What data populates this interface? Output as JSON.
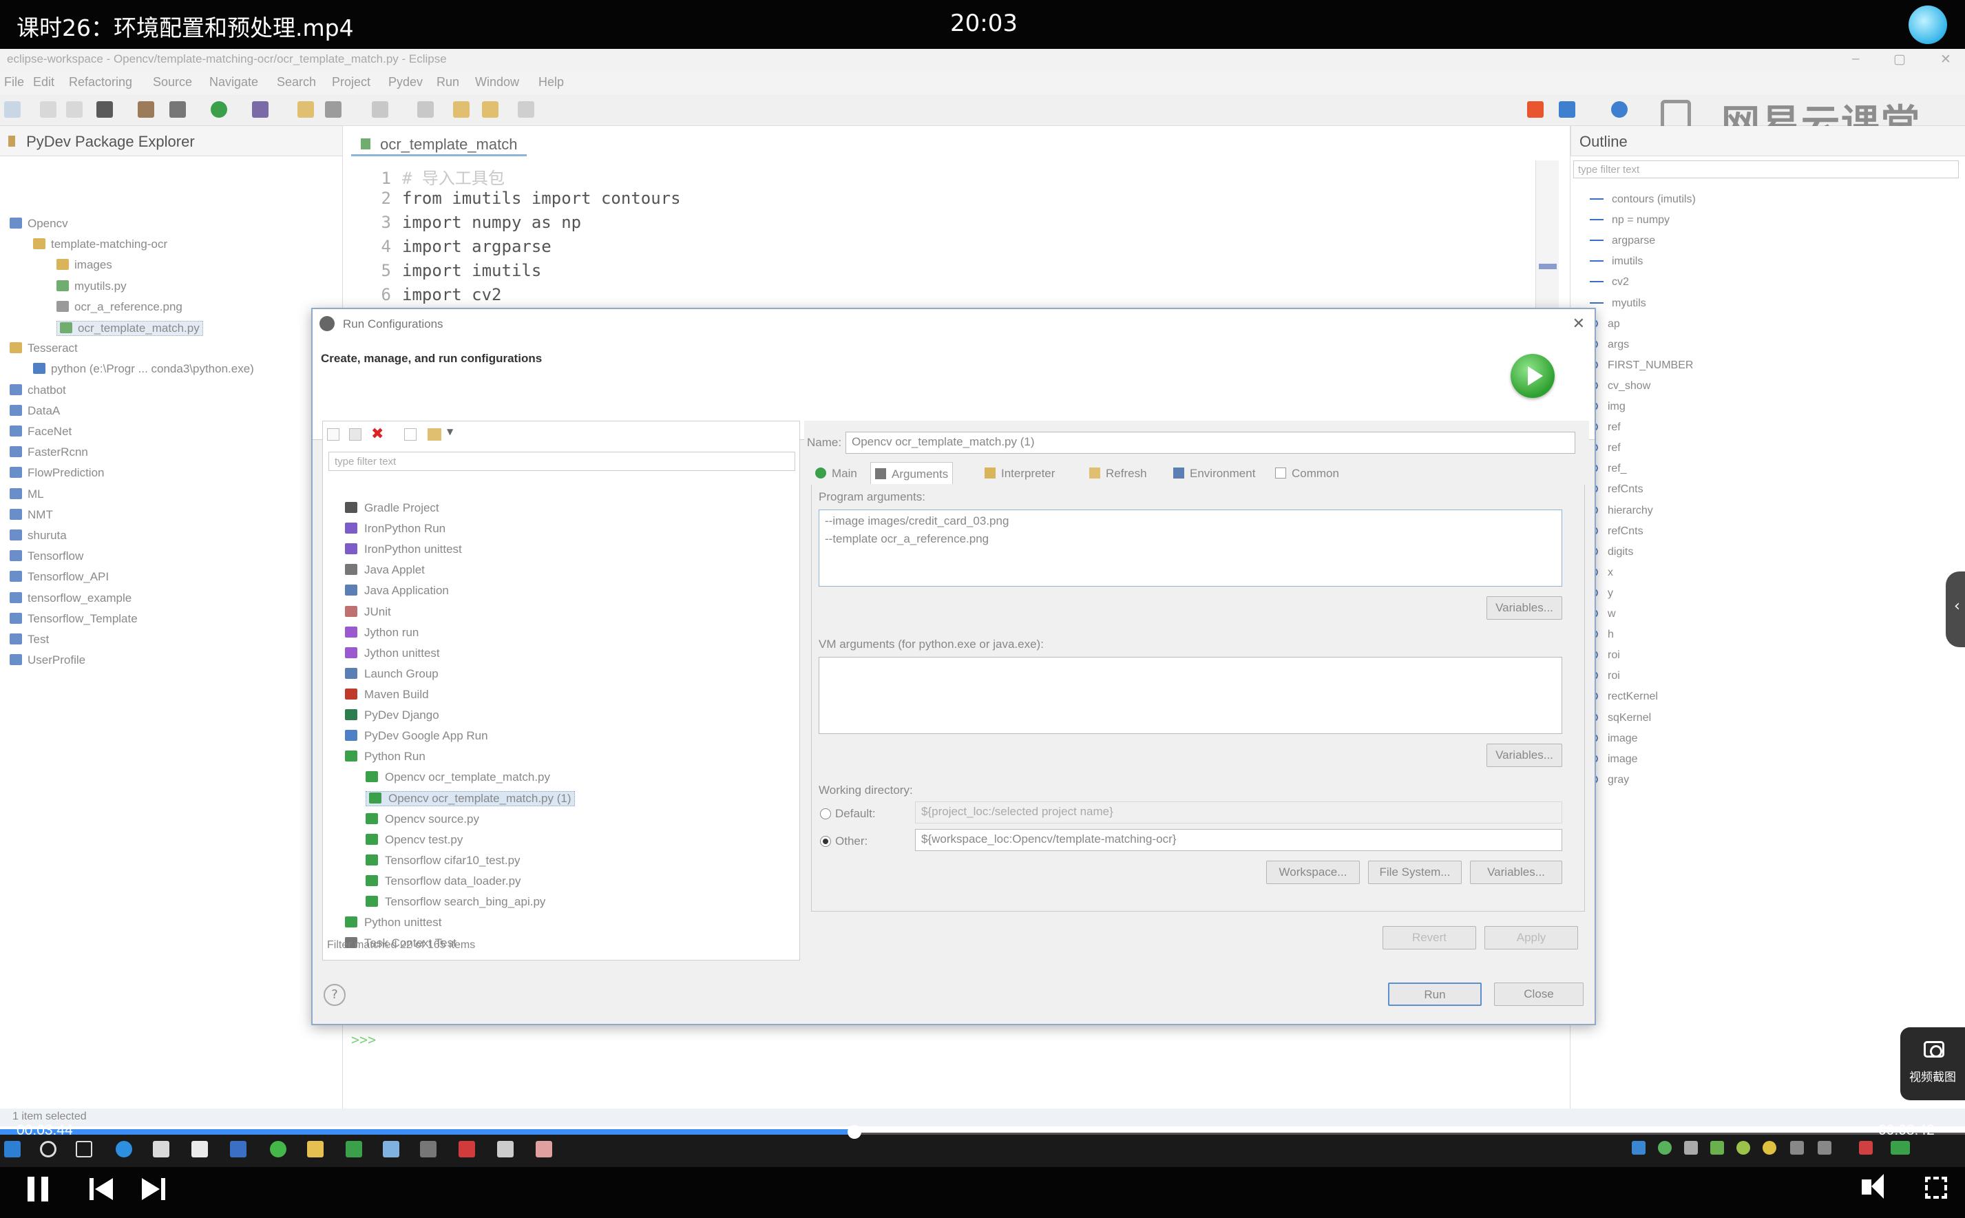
{
  "video": {
    "title": "课时26：环境配置和预处理.mp4",
    "clock": "20:03",
    "time_current": "00:03:44",
    "time_total": "00:08:42",
    "progress": 0.435,
    "screenshot_label": "视频截图"
  },
  "eclipse": {
    "window_title": "eclipse-workspace - Opencv/template-matching-ocr/ocr_template_match.py - Eclipse",
    "menu": [
      "File",
      "Edit",
      "Refactoring",
      "Source",
      "Navigate",
      "Search",
      "Project",
      "Pydev",
      "Run",
      "Window",
      "Help"
    ],
    "watermark": "网易云课堂",
    "package_explorer": {
      "title": "PyDev Package Explorer",
      "tree": [
        {
          "label": "Opencv",
          "depth": 0,
          "color": "#6a8ec9"
        },
        {
          "label": "template-matching-ocr",
          "depth": 1,
          "color": "#d9b45a"
        },
        {
          "label": "images",
          "depth": 2,
          "color": "#d9b45a"
        },
        {
          "label": "myutils.py",
          "depth": 2,
          "color": "#6fae6f"
        },
        {
          "label": "ocr_a_reference.png",
          "depth": 2,
          "color": "#9a9a9a"
        },
        {
          "label": "ocr_template_match.py",
          "depth": 2,
          "color": "#6fae6f",
          "selected": true
        },
        {
          "label": "Tesseract",
          "depth": 0,
          "color": "#d9b45a"
        },
        {
          "label": "python  (e:\\Progr ... conda3\\python.exe)",
          "depth": 1,
          "color": "#4f7fc4"
        },
        {
          "label": "chatbot",
          "depth": 0,
          "color": "#6a8ec9"
        },
        {
          "label": "DataA",
          "depth": 0,
          "color": "#6a8ec9"
        },
        {
          "label": "FaceNet",
          "depth": 0,
          "color": "#6a8ec9"
        },
        {
          "label": "FasterRcnn",
          "depth": 0,
          "color": "#6a8ec9"
        },
        {
          "label": "FlowPrediction",
          "depth": 0,
          "color": "#6a8ec9"
        },
        {
          "label": "ML",
          "depth": 0,
          "color": "#6a8ec9"
        },
        {
          "label": "NMT",
          "depth": 0,
          "color": "#6a8ec9"
        },
        {
          "label": "shuruta",
          "depth": 0,
          "color": "#6a8ec9"
        },
        {
          "label": "Tensorflow",
          "depth": 0,
          "color": "#6a8ec9"
        },
        {
          "label": "Tensorflow_API",
          "depth": 0,
          "color": "#6a8ec9"
        },
        {
          "label": "tensorflow_example",
          "depth": 0,
          "color": "#6a8ec9"
        },
        {
          "label": "Tensorflow_Template",
          "depth": 0,
          "color": "#6a8ec9"
        },
        {
          "label": "Test",
          "depth": 0,
          "color": "#6a8ec9"
        },
        {
          "label": "UserProfile",
          "depth": 0,
          "color": "#6a8ec9"
        }
      ]
    },
    "editor": {
      "tab": "ocr_template_match",
      "lines": [
        {
          "n": "1",
          "text": "# 导入工具包"
        },
        {
          "n": "2",
          "text": "from imutils import contours"
        },
        {
          "n": "3",
          "text": "import numpy as np"
        },
        {
          "n": "4",
          "text": "import argparse"
        },
        {
          "n": "5",
          "text": "import imutils"
        },
        {
          "n": "6",
          "text": "import cv2"
        }
      ]
    },
    "outline": {
      "title": "Outline",
      "filter_placeholder": "type filter text",
      "items": [
        "contours (imutils)",
        "np = numpy",
        "argparse",
        "imutils",
        "cv2",
        "myutils",
        "ap",
        "args",
        "FIRST_NUMBER",
        "cv_show",
        "img",
        "ref",
        "ref",
        "ref_",
        "refCnts",
        "hierarchy",
        "refCnts",
        "digits",
        "x",
        "y",
        "w",
        "h",
        "roi",
        "roi",
        "rectKernel",
        "sqKernel",
        "image",
        "image",
        "gray"
      ]
    },
    "console_prompt": ">>>",
    "status": "1 item selected"
  },
  "dialog": {
    "title": "Run Configurations",
    "subtitle": "Create, manage, and run configurations",
    "filter_placeholder": "type filter text",
    "configs": [
      {
        "label": "Gradle Project",
        "depth": 0,
        "color": "#555"
      },
      {
        "label": "IronPython Run",
        "depth": 0,
        "color": "#7b5cc9"
      },
      {
        "label": "IronPython unittest",
        "depth": 0,
        "color": "#7b5cc9"
      },
      {
        "label": "Java Applet",
        "depth": 0,
        "color": "#777"
      },
      {
        "label": "Java Application",
        "depth": 0,
        "color": "#5b7fb5"
      },
      {
        "label": "JUnit",
        "depth": 0,
        "color": "#c07070"
      },
      {
        "label": "Jython run",
        "depth": 0,
        "color": "#9b59d0"
      },
      {
        "label": "Jython unittest",
        "depth": 0,
        "color": "#9b59d0"
      },
      {
        "label": "Launch Group",
        "depth": 0,
        "color": "#5b7fb5"
      },
      {
        "label": "Maven Build",
        "depth": 0,
        "color": "#c0392b"
      },
      {
        "label": "PyDev Django",
        "depth": 0,
        "color": "#2e7d4f"
      },
      {
        "label": "PyDev Google App Run",
        "depth": 0,
        "color": "#4f7fc4"
      },
      {
        "label": "Python Run",
        "depth": 0,
        "color": "#3aa04a"
      },
      {
        "label": "Opencv ocr_template_match.py",
        "depth": 1,
        "color": "#3aa04a"
      },
      {
        "label": "Opencv ocr_template_match.py (1)",
        "depth": 1,
        "color": "#3aa04a",
        "selected": true
      },
      {
        "label": "Opencv source.py",
        "depth": 1,
        "color": "#3aa04a"
      },
      {
        "label": "Opencv test.py",
        "depth": 1,
        "color": "#3aa04a"
      },
      {
        "label": "Tensorflow cifar10_test.py",
        "depth": 1,
        "color": "#3aa04a"
      },
      {
        "label": "Tensorflow data_loader.py",
        "depth": 1,
        "color": "#3aa04a"
      },
      {
        "label": "Tensorflow search_bing_api.py",
        "depth": 1,
        "color": "#3aa04a"
      },
      {
        "label": "Python unittest",
        "depth": 0,
        "color": "#3aa04a"
      },
      {
        "label": "Task Context Test",
        "depth": 0,
        "color": "#777"
      }
    ],
    "filter_status": "Filter matched 22 of 165 items",
    "name_label": "Name:",
    "name_value": "Opencv ocr_template_match.py (1)",
    "tabs": [
      "Main",
      "Arguments",
      "Interpreter",
      "Refresh",
      "Environment",
      "Common"
    ],
    "active_tab": "Arguments",
    "program_args_label": "Program arguments:",
    "program_args": [
      "--image images/credit_card_03.png",
      "--template ocr_a_reference.png"
    ],
    "variables_label": "Variables...",
    "vm_args_label": "VM arguments (for python.exe or java.exe):",
    "workdir_label": "Working directory:",
    "default_label": "Default:",
    "default_value": "${project_loc:/selected project name}",
    "other_label": "Other:",
    "other_value": "${workspace_loc:Opencv/template-matching-ocr}",
    "workspace_btn": "Workspace...",
    "filesystem_btn": "File System...",
    "revert_btn": "Revert",
    "apply_btn": "Apply",
    "run_btn": "Run",
    "close_btn": "Close",
    "help_icon": "?"
  }
}
